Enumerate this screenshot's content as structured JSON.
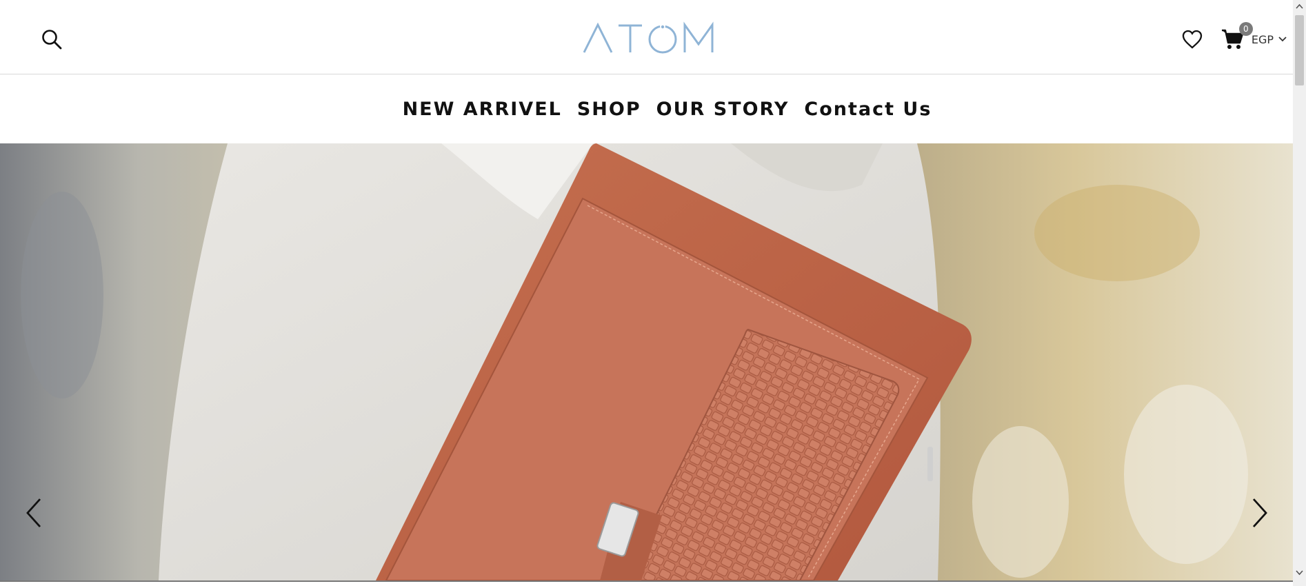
{
  "header": {
    "logo_text": "ATOM",
    "icons": {
      "search": "search-icon",
      "wishlist": "heart-icon",
      "cart": "cart-icon",
      "currency_caret": "chevron-down-icon"
    },
    "cart_count": "0",
    "currency": "EGP"
  },
  "nav": {
    "items": [
      {
        "label": "NEW ARRIVEL"
      },
      {
        "label": "SHOP"
      },
      {
        "label": "OUR STORY"
      },
      {
        "label": "Contact Us"
      }
    ]
  },
  "hero": {
    "image": "brown leather portfolio held under arm",
    "prev_icon": "chevron-left-icon",
    "next_icon": "chevron-right-icon"
  },
  "colors": {
    "logo": "#8fb4d6",
    "nav_text": "#111111",
    "leather": "#c06f52"
  }
}
